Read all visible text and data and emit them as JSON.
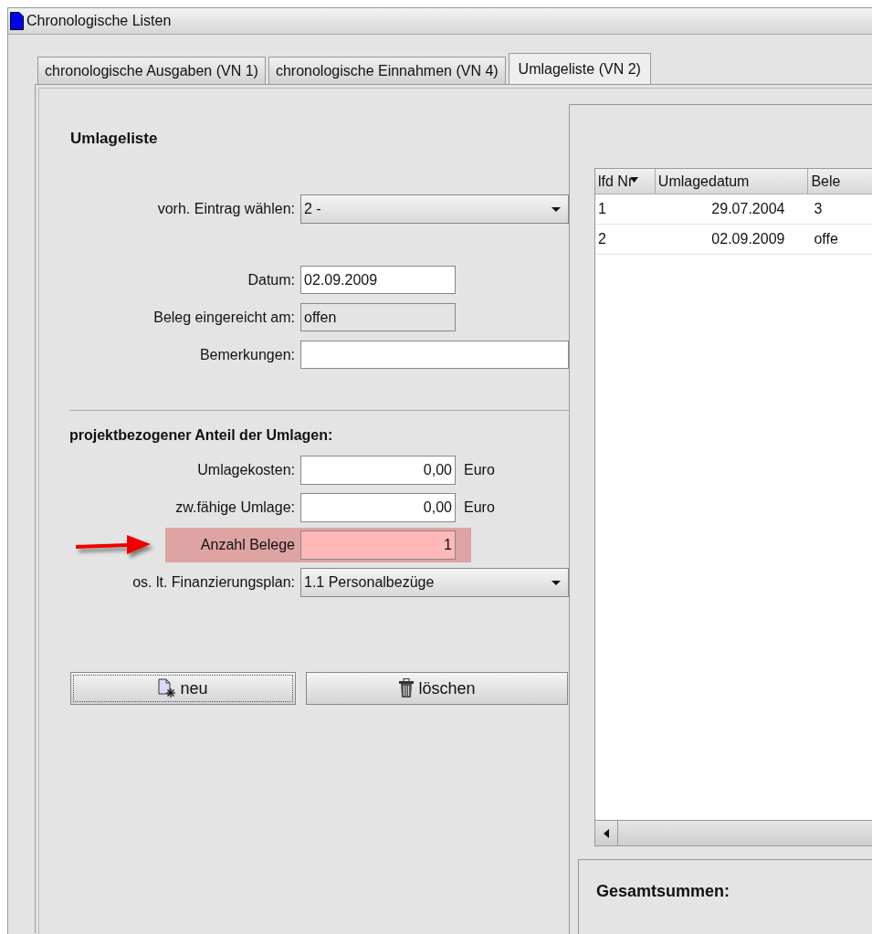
{
  "window": {
    "title": "Chronologische Listen"
  },
  "tabs": [
    {
      "label": "chronologische Ausgaben (VN 1)",
      "selected": false
    },
    {
      "label": "chronologische Einnahmen (VN 4)",
      "selected": false
    },
    {
      "label": "Umlageliste (VN 2)",
      "selected": true
    }
  ],
  "form": {
    "heading": "Umlageliste",
    "entry_row": {
      "kind": "combo",
      "label": "vorh. Eintrag wählen:",
      "value": "2 -"
    },
    "rows": [
      {
        "kind": "text",
        "label": "Datum:",
        "value": "02.09.2009"
      },
      {
        "kind": "readonly",
        "label": "Beleg eingereicht am:",
        "value": "offen"
      },
      {
        "kind": "wide",
        "label": "Bemerkungen:"
      }
    ],
    "section_heading": "projektbezogener Anteil der Umlagen:",
    "amount_rows": [
      {
        "kind": "number",
        "label": "Umlagekosten:",
        "value": "0,00",
        "unit": "Euro",
        "highlighted": false
      },
      {
        "kind": "number",
        "label": "zw.fähige Umlage:",
        "value": "0,00",
        "unit": "Euro",
        "highlighted": false
      },
      {
        "kind": "number",
        "label": "Anzahl Belege",
        "value": "1",
        "highlighted": true
      },
      {
        "kind": "combo",
        "label": "os. lt. Finanzierungsplan:",
        "value": "1.1 Personalbezüge",
        "highlighted": false
      }
    ],
    "buttons": [
      {
        "kind": "new",
        "label": "neu",
        "focused": true
      },
      {
        "kind": "delete",
        "label": "löschen",
        "focused": false
      }
    ]
  },
  "table": {
    "columns": [
      {
        "label": "lfd Nr",
        "sorted": true
      },
      {
        "label": "Umlagedatum",
        "sorted": false
      },
      {
        "label": "Bele",
        "sorted": false
      }
    ],
    "rows": [
      [
        "1",
        "29.07.2004",
        "3"
      ],
      [
        "2",
        "02.09.2009",
        "offe"
      ]
    ]
  },
  "totals": {
    "heading": "Gesamtsummen:"
  }
}
